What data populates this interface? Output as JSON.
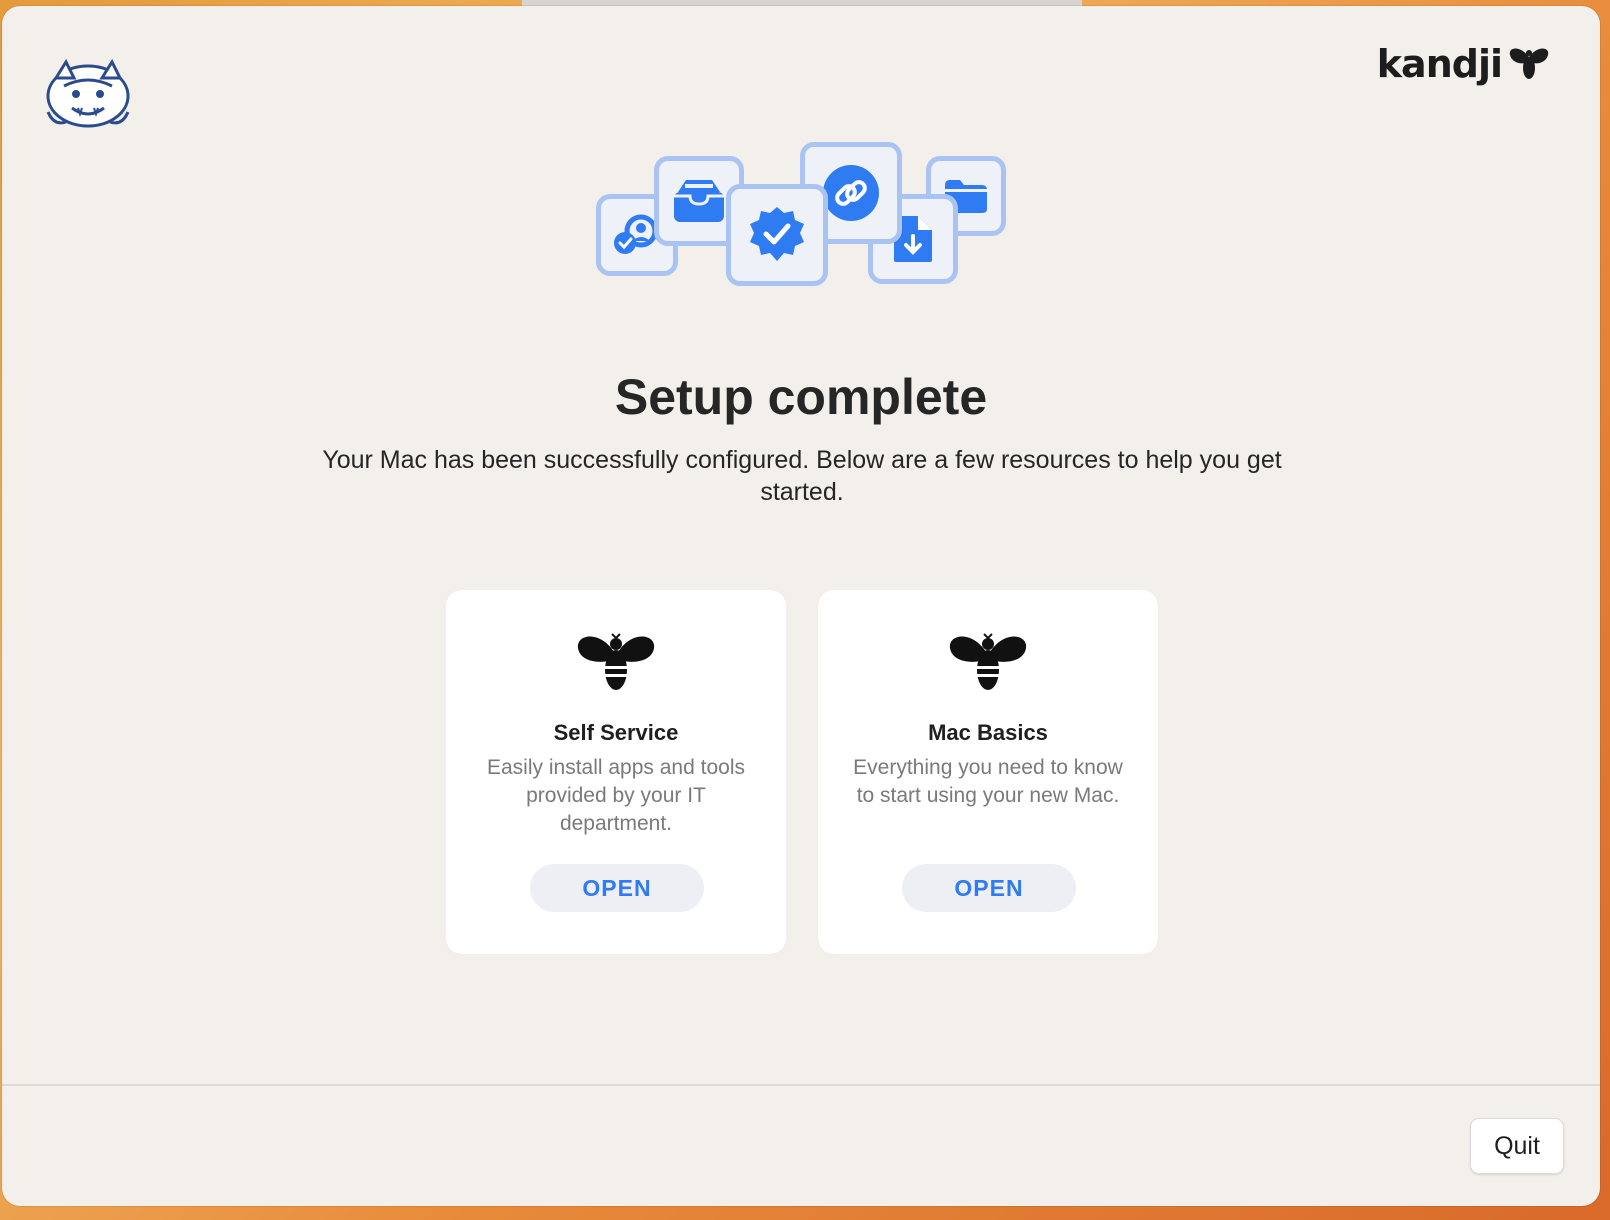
{
  "header": {
    "brand_name": "kandji",
    "org_logo_icon": "wildcat-mascot-icon",
    "brand_icon": "bee-icon"
  },
  "hero": {
    "icons": [
      "user-check-icon",
      "inbox-tray-icon",
      "verified-badge-icon",
      "link-icon",
      "document-download-icon",
      "folder-icon"
    ],
    "accent_color": "#2f7bf2",
    "tile_border_color": "#a9c3f2"
  },
  "main": {
    "title": "Setup complete",
    "subtitle": "Your Mac has been successfully configured. Below are a few resources to help you get started."
  },
  "cards": [
    {
      "icon": "bee-icon",
      "title": "Self Service",
      "description": "Easily install apps and tools provided by your IT department.",
      "button_label": "OPEN"
    },
    {
      "icon": "bee-icon",
      "title": "Mac Basics",
      "description": "Everything you need to know to start using your new Mac.",
      "button_label": "OPEN"
    }
  ],
  "footer": {
    "quit_label": "Quit"
  }
}
